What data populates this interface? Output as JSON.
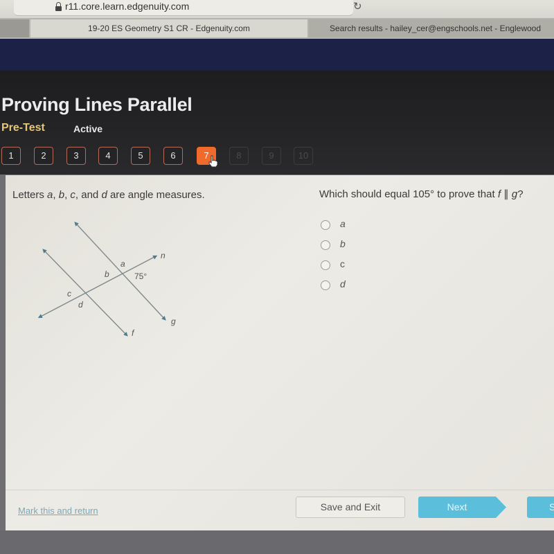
{
  "browser": {
    "url": "r11.core.learn.edgenuity.com",
    "tabs": [
      {
        "label": "19-20 ES Geometry S1 CR - Edgenuity.com",
        "active": true
      },
      {
        "label": "Search results - hailey_cer@engschools.net - Englewood",
        "active": false
      }
    ]
  },
  "header": {
    "title": "Proving Lines Parallel",
    "subtitle": "Pre-Test",
    "status": "Active"
  },
  "question_nav": {
    "current": 7,
    "items": [
      {
        "label": "1",
        "state": "answered"
      },
      {
        "label": "2",
        "state": "answered"
      },
      {
        "label": "3",
        "state": "answered"
      },
      {
        "label": "4",
        "state": "answered"
      },
      {
        "label": "5",
        "state": "answered"
      },
      {
        "label": "6",
        "state": "answered"
      },
      {
        "label": "7",
        "state": "current"
      },
      {
        "label": "8",
        "state": "locked"
      },
      {
        "label": "9",
        "state": "locked"
      },
      {
        "label": "10",
        "state": "locked"
      }
    ]
  },
  "prompt": {
    "pre": "Letters ",
    "a": "a",
    "sep1": ", ",
    "b": "b",
    "sep2": ", ",
    "c": "c",
    "sep3": ", and ",
    "d": "d",
    "post": " are angle measures."
  },
  "question": {
    "pre": "Which should equal 105° to prove that ",
    "f": "f",
    "symbol": " ∥ ",
    "g": "g",
    "post": "?"
  },
  "diagram": {
    "lines": [
      "f",
      "g",
      "n"
    ],
    "angle_labels": {
      "a": "a",
      "b": "b",
      "c": "c",
      "d": "d"
    },
    "given_angle": "75°",
    "line_labels": {
      "f": "f",
      "g": "g",
      "n": "n"
    },
    "line_color": "#7e8a8e",
    "arrow_color": "#4d7c8c"
  },
  "options": [
    {
      "label": "a",
      "selected": false
    },
    {
      "label": "b",
      "selected": false
    },
    {
      "label": "c",
      "selected": false
    },
    {
      "label": "d",
      "selected": false
    }
  ],
  "footer": {
    "mark_link": "Mark this and return",
    "save_exit": "Save and Exit",
    "next": "Next",
    "submit": "S"
  },
  "colors": {
    "accent_orange": "#f06a2b",
    "button_blue": "#5bbfdc",
    "subtitle_gold": "#e6c77a",
    "nav_blue": "#1c2147"
  }
}
